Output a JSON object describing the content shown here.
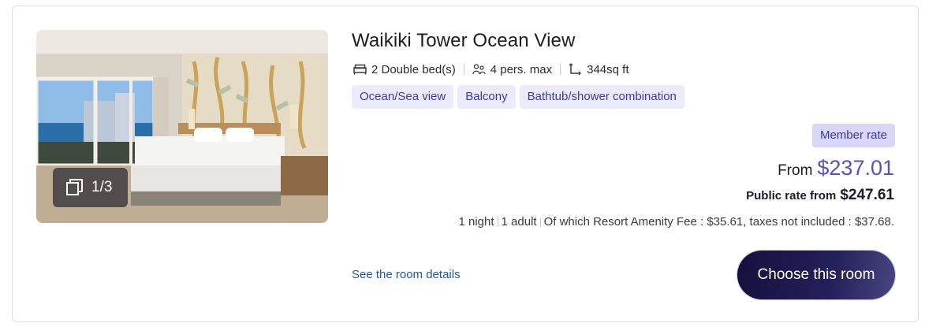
{
  "room": {
    "title": "Waikiki Tower Ocean View",
    "specs": {
      "beds": "2 Double bed(s)",
      "persons": "4 pers. max",
      "area": "344sq ft"
    },
    "tags": [
      "Ocean/Sea view",
      "Balcony",
      "Bathtub/shower combination"
    ],
    "gallery_counter": "1/3"
  },
  "pricing": {
    "member_badge": "Member rate",
    "from_label": "From",
    "member_price": "$237.01",
    "public_label": "Public rate from",
    "public_price": "$247.61",
    "stay": {
      "nights": "1 night",
      "adults": "1 adult",
      "fees_note": "Of which Resort Amenity Fee : $35.61, taxes not included : $37.68."
    }
  },
  "actions": {
    "details_link": "See the room details",
    "choose_button": "Choose this room"
  },
  "colors": {
    "accent_price": "#5650c9",
    "tag_bg": "#ecebfb",
    "member_badge_bg": "#d9d6f7",
    "button_dark": "#14103d",
    "link": "#1e55b3"
  },
  "icons": [
    "bed-icon",
    "persons-icon",
    "area-icon",
    "gallery-icon"
  ]
}
